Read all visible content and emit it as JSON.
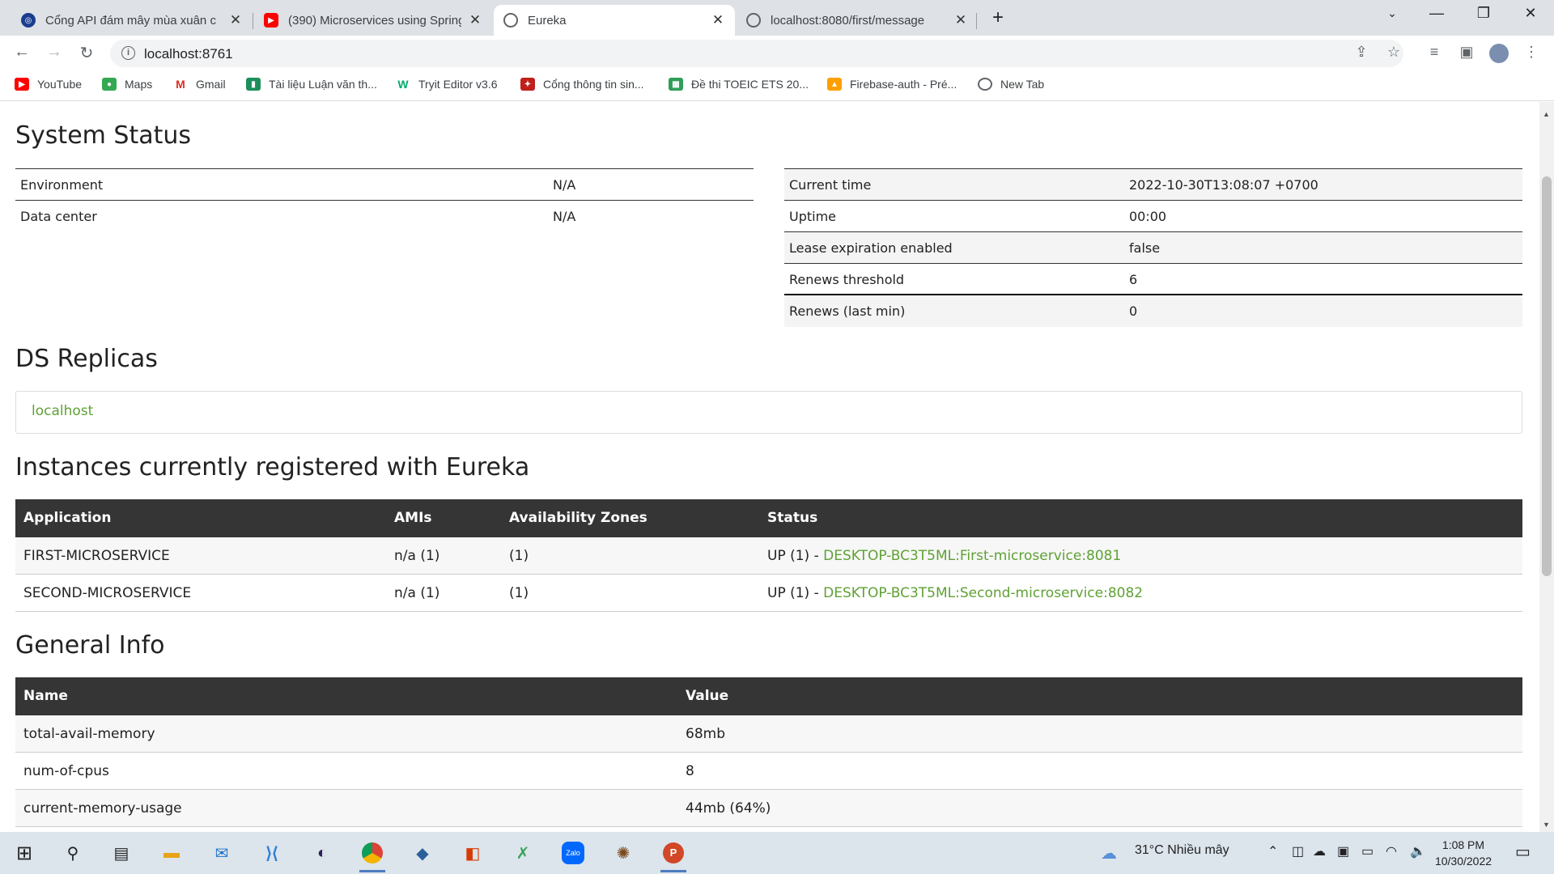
{
  "browser": {
    "tabs": [
      {
        "title": "Cổng API đám mây mùa xuân c",
        "active": false
      },
      {
        "title": "(390) Microservices using Spring",
        "active": false
      },
      {
        "title": "Eureka",
        "active": true
      },
      {
        "title": "localhost:8080/first/message",
        "active": false
      }
    ],
    "url": "localhost:8761",
    "bookmarks": [
      "YouTube",
      "Maps",
      "Gmail",
      "Tài liệu Luận văn th...",
      "Tryit Editor v3.6",
      "Cổng thông tin sin...",
      "Đề thi TOEIC ETS 20...",
      "Firebase-auth - Pré...",
      "New Tab"
    ]
  },
  "page": {
    "system_status": {
      "heading": "System Status",
      "left": [
        {
          "label": "Environment",
          "value": "N/A"
        },
        {
          "label": "Data center",
          "value": "N/A"
        }
      ],
      "right": [
        {
          "label": "Current time",
          "value": "2022-10-30T13:08:07 +0700"
        },
        {
          "label": "Uptime",
          "value": "00:00"
        },
        {
          "label": "Lease expiration enabled",
          "value": "false"
        },
        {
          "label": "Renews threshold",
          "value": "6"
        },
        {
          "label": "Renews (last min)",
          "value": "0"
        }
      ]
    },
    "ds_replicas": {
      "heading": "DS Replicas",
      "items": [
        "localhost"
      ]
    },
    "instances": {
      "heading": "Instances currently registered with Eureka",
      "columns": [
        "Application",
        "AMIs",
        "Availability Zones",
        "Status"
      ],
      "rows": [
        {
          "application": "FIRST-MICROSERVICE",
          "amis": "n/a (1)",
          "zones": "(1)",
          "status": "UP (1) - ",
          "instance": "DESKTOP-BC3T5ML:First-microservice:8081"
        },
        {
          "application": "SECOND-MICROSERVICE",
          "amis": "n/a (1)",
          "zones": "(1)",
          "status": "UP (1) - ",
          "instance": "DESKTOP-BC3T5ML:Second-microservice:8082"
        }
      ]
    },
    "general_info": {
      "heading": "General Info",
      "columns": [
        "Name",
        "Value"
      ],
      "rows": [
        {
          "name": "total-avail-memory",
          "value": "68mb"
        },
        {
          "name": "num-of-cpus",
          "value": "8"
        },
        {
          "name": "current-memory-usage",
          "value": "44mb (64%)"
        }
      ]
    }
  },
  "taskbar": {
    "weather": "31°C  Nhiều mây",
    "time": "1:08 PM",
    "date": "10/30/2022"
  },
  "colors": {
    "link": "#5fa134",
    "table_header": "#353535",
    "tabstrip": "#dee1e6",
    "taskbar": "#dce4ec"
  }
}
